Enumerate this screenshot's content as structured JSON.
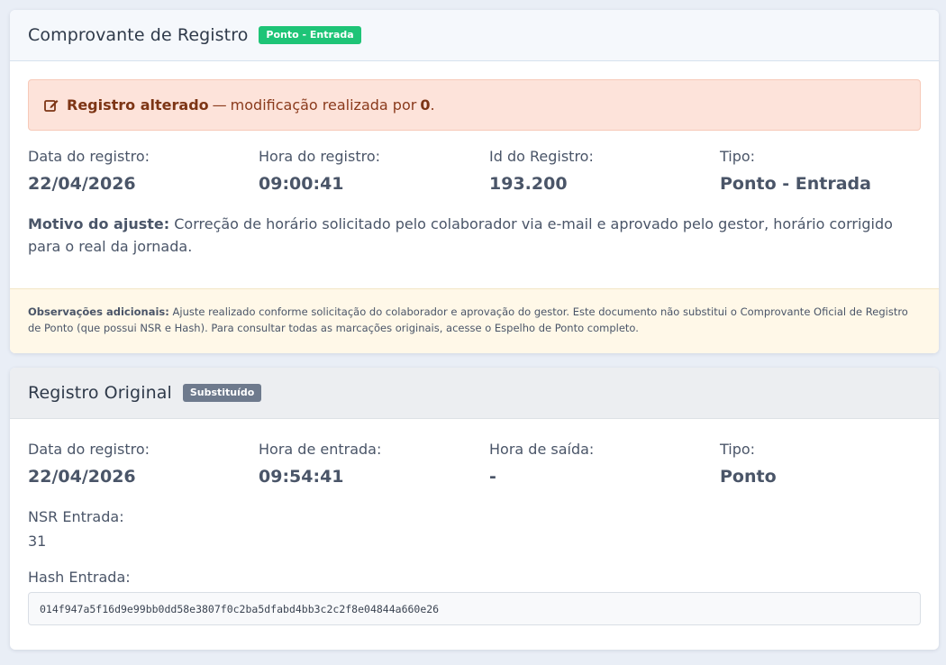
{
  "receipt": {
    "title": "Comprovante de Registro",
    "badge": "Ponto - Entrada",
    "alert": {
      "icon": "edit-icon",
      "strong": "Registro alterado",
      "dash": "—",
      "text": "modificação realizada por",
      "by": "0",
      "end": "."
    },
    "fields": [
      {
        "label": "Data do registro:",
        "value": "22/04/2026"
      },
      {
        "label": "Hora do registro:",
        "value": "09:00:41"
      },
      {
        "label": "Id do Registro:",
        "value": "193.200"
      },
      {
        "label": "Tipo:",
        "value": "Ponto - Entrada"
      }
    ],
    "reason_label": "Motivo do ajuste:",
    "reason_text": "Correção de horário solicitado pelo colaborador via e-mail e aprovado pelo gestor, horário corrigido para o real da jornada.",
    "notes_label": "Observações adicionais:",
    "notes_text": "Ajuste realizado conforme solicitação do colaborador e aprovação do gestor. Este documento não substitui o Comprovante Oficial de Registro de Ponto (que possui NSR e Hash). Para consultar todas as marcações originais, acesse o Espelho de Ponto completo."
  },
  "original": {
    "title": "Registro Original",
    "badge": "Substituído",
    "fields": [
      {
        "label": "Data do registro:",
        "value": "22/04/2026"
      },
      {
        "label": "Hora de entrada:",
        "value": "09:54:41"
      },
      {
        "label": "Hora de saída:",
        "value": "-"
      },
      {
        "label": "Tipo:",
        "value": "Ponto"
      }
    ],
    "nsr_label": "NSR Entrada:",
    "nsr_value": "31",
    "hash_label": "Hash Entrada:",
    "hash_value": "014f947a5f16d9e99bb0dd58e3807f0c2ba5dfabd4bb3c2c2f8e04844a660e26"
  },
  "colors": {
    "badge_green": "#1ec477",
    "badge_gray": "#6e7a8d",
    "alert_bg": "#fde3da",
    "notes_bg": "#fff8e8"
  }
}
